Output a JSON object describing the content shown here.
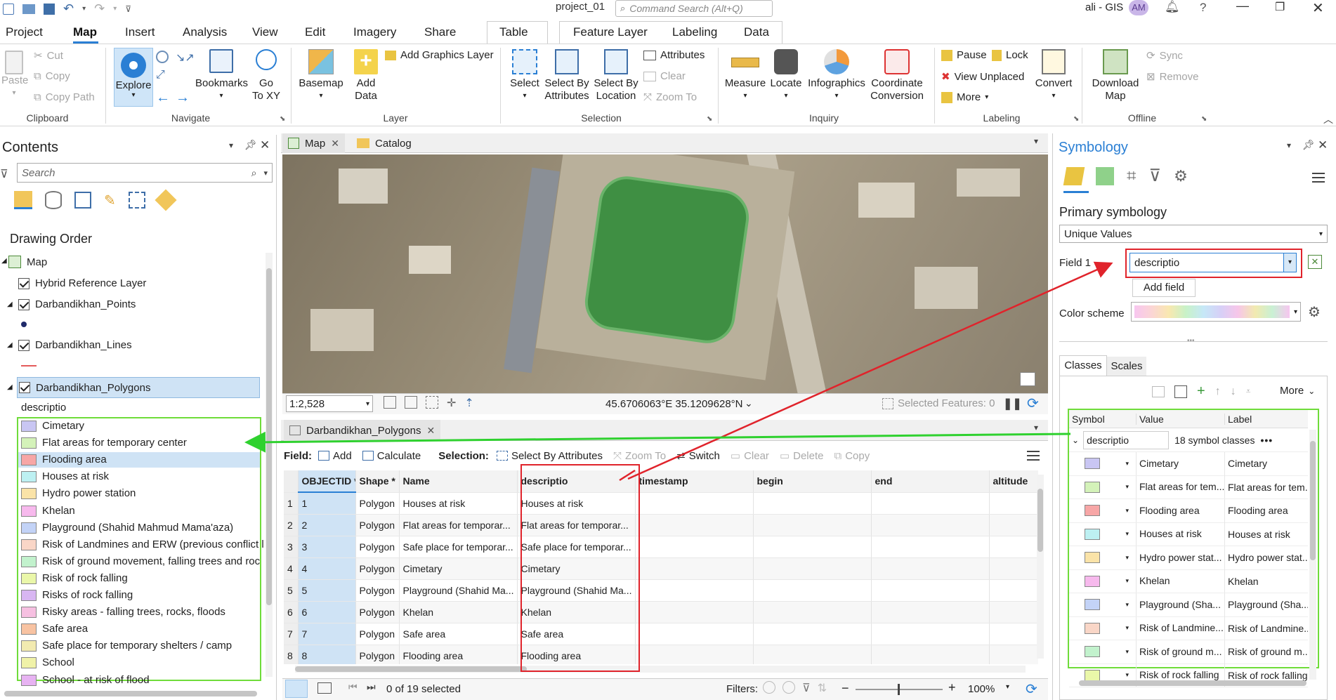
{
  "titlebar": {
    "project": "project_01",
    "search_placeholder": "Command Search (Alt+Q)",
    "user": "ali - GIS",
    "initials": "AM"
  },
  "tabs": [
    "Project",
    "Map",
    "Insert",
    "Analysis",
    "View",
    "Edit",
    "Imagery",
    "Share",
    "Table",
    "Feature Layer",
    "Labeling",
    "Data"
  ],
  "ribbon": {
    "clipboard": {
      "paste": "Paste",
      "cut": "Cut",
      "copy": "Copy",
      "copy_path": "Copy Path",
      "group": "Clipboard"
    },
    "navigate": {
      "explore": "Explore",
      "bookmarks": "Bookmarks",
      "goto": "Go\nTo XY",
      "group": "Navigate"
    },
    "layer": {
      "basemap": "Basemap",
      "add_data": "Add\nData",
      "add_graphics": "Add Graphics Layer",
      "group": "Layer"
    },
    "selection": {
      "select": "Select",
      "by_attr": "Select By\nAttributes",
      "by_loc": "Select By\nLocation",
      "attributes": "Attributes",
      "clear": "Clear",
      "zoom_to": "Zoom To",
      "group": "Selection"
    },
    "inquiry": {
      "measure": "Measure",
      "locate": "Locate",
      "infographics": "Infographics",
      "coord": "Coordinate\nConversion",
      "group": "Inquiry"
    },
    "labeling": {
      "pause": "Pause",
      "lock": "Lock",
      "view_unplaced": "View Unplaced",
      "more": "More",
      "convert": "Convert",
      "group": "Labeling"
    },
    "offline": {
      "download": "Download\nMap",
      "sync": "Sync",
      "remove": "Remove",
      "group": "Offline"
    }
  },
  "contents": {
    "title": "Contents",
    "search_placeholder": "Search",
    "drawing_order": "Drawing Order",
    "map": "Map",
    "layers": [
      "Hybrid Reference Layer",
      "Darbandikhan_Points",
      "Darbandikhan_Lines",
      "Darbandikhan_Polygons"
    ],
    "field": "descriptio",
    "legend": [
      {
        "label": "Cimetary",
        "color": "#c9c6f3"
      },
      {
        "label": "Flat areas for temporary center",
        "color": "#d4f2b9"
      },
      {
        "label": "Flooding area",
        "color": "#f7a6a6"
      },
      {
        "label": "Houses at risk",
        "color": "#bdf0f2"
      },
      {
        "label": "Hydro power station",
        "color": "#fae3a8"
      },
      {
        "label": "Khelan",
        "color": "#f7b9ed"
      },
      {
        "label": "Playground (Shahid Mahmud Mama'aza)",
        "color": "#c3d3f7"
      },
      {
        "label": "Risk of Landmines and ERW (previous conflict l",
        "color": "#f9d6c7"
      },
      {
        "label": "Risk of ground movement, falling trees and roc",
        "color": "#c2f2cd"
      },
      {
        "label": "Risk of rock falling",
        "color": "#eaf7a9"
      },
      {
        "label": "Risks of rock falling",
        "color": "#d8b6f2"
      },
      {
        "label": "Risky areas - falling trees, rocks, floods",
        "color": "#f6c0e1"
      },
      {
        "label": "Safe area",
        "color": "#f8c3a2"
      },
      {
        "label": "Safe place for temporary shelters / camp",
        "color": "#f2eab0"
      },
      {
        "label": "School",
        "color": "#f0f2a8"
      },
      {
        "label": "School - at risk of flood",
        "color": "#e7b3f2"
      }
    ]
  },
  "map_view": {
    "tab_map": "Map",
    "tab_catalog": "Catalog",
    "scale": "1:2,528",
    "coords": "45.6706063°E 35.1209628°N",
    "selected": "Selected Features: 0"
  },
  "table_view": {
    "tab": "Darbandikhan_Polygons",
    "field_label": "Field:",
    "add": "Add",
    "calculate": "Calculate",
    "selection_label": "Selection:",
    "select_by_attr": "Select By Attributes",
    "zoom_to": "Zoom To",
    "switch": "Switch",
    "clear": "Clear",
    "delete": "Delete",
    "copy": "Copy",
    "columns": [
      "OBJECTID *",
      "Shape *",
      "Name",
      "descriptio",
      "timestamp",
      "begin",
      "end",
      "altitude"
    ],
    "rows": [
      [
        "1",
        "1",
        "Polygon",
        "Houses at risk",
        "Houses at risk"
      ],
      [
        "2",
        "2",
        "Polygon",
        "Flat areas for temporar...",
        "Flat areas for temporar..."
      ],
      [
        "3",
        "3",
        "Polygon",
        "Safe place for temporar...",
        "Safe place for temporar..."
      ],
      [
        "4",
        "4",
        "Polygon",
        "Cimetary",
        "Cimetary"
      ],
      [
        "5",
        "5",
        "Polygon",
        "Playground (Shahid Ma...",
        "Playground (Shahid Ma..."
      ],
      [
        "6",
        "6",
        "Polygon",
        "Khelan",
        "Khelan"
      ],
      [
        "7",
        "7",
        "Polygon",
        "Safe area",
        "Safe area"
      ],
      [
        "8",
        "8",
        "Polygon",
        "Flooding area",
        "Flooding area"
      ]
    ],
    "status": "0 of 19 selected",
    "filters": "Filters:",
    "zoom": "100%"
  },
  "symbology": {
    "title": "Symbology",
    "primary": "Primary symbology",
    "method": "Unique Values",
    "field1_label": "Field 1",
    "field1_value": "descriptio",
    "add_field": "Add field",
    "color_scheme_label": "Color scheme",
    "tab_classes": "Classes",
    "tab_scales": "Scales",
    "more": "More",
    "col_symbol": "Symbol",
    "col_value": "Value",
    "col_label": "Label",
    "group_field": "descriptio",
    "group_count": "18 symbol classes",
    "classes": [
      {
        "value": "Cimetary",
        "label": "Cimetary",
        "color": "#c9c6f3"
      },
      {
        "value": "Flat areas for tem...",
        "label": "Flat areas for tem...",
        "color": "#d4f2b9"
      },
      {
        "value": "Flooding area",
        "label": "Flooding area",
        "color": "#f7a6a6"
      },
      {
        "value": "Houses at risk",
        "label": "Houses at risk",
        "color": "#bdf0f2"
      },
      {
        "value": "Hydro power stat...",
        "label": "Hydro power stat...",
        "color": "#fae3a8"
      },
      {
        "value": "Khelan",
        "label": "Khelan",
        "color": "#f7b9ed"
      },
      {
        "value": "Playground (Sha...",
        "label": "Playground (Sha...",
        "color": "#c3d3f7"
      },
      {
        "value": "Risk of Landmine...",
        "label": "Risk of Landmine...",
        "color": "#f9d6c7"
      },
      {
        "value": "Risk of ground m...",
        "label": "Risk of ground m...",
        "color": "#c2f2cd"
      },
      {
        "value": "Risk of rock falling",
        "label": "Risk of rock falling",
        "color": "#eaf7a9"
      }
    ]
  },
  "colors": {
    "accent": "#2a7fd4",
    "highlight_red": "#e0232b",
    "highlight_green": "#6fdc3a",
    "selected_row": "#cfe3f5"
  }
}
